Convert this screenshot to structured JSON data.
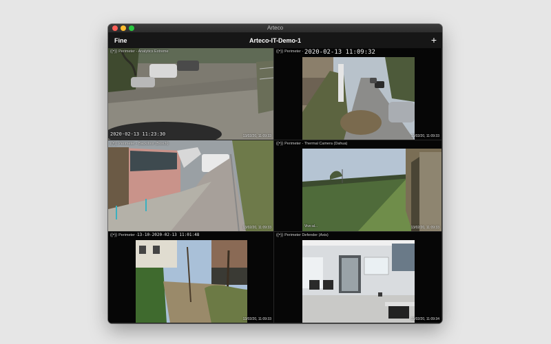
{
  "window": {
    "title": "Arteco",
    "toolbar": {
      "done_label": "Fine",
      "title": "Arteco-IT-Demo-1",
      "add_label": "+"
    }
  },
  "cameras": [
    {
      "label": "Perimeter - Analytics Extreme",
      "timestamp": "13/02/20, 11:09:33",
      "osd": "2020-02-13 11:23:30"
    },
    {
      "label": "Perimeter - ",
      "timestamp": "13/02/20, 11:09:33",
      "osd": "2020-02-13 11:09:32"
    },
    {
      "label": "Perimeter - Backdoor (Bosch)",
      "timestamp": "13/02/20, 11:09:33"
    },
    {
      "label": "Perimeter - Thermal Camera (Dahua)",
      "timestamp": "13/02/20, 11:09:33",
      "osd": "Vivo al..."
    },
    {
      "label": "Perimeter - ",
      "timestamp": "13/02/20, 11:09:33",
      "osd": "13-10-2020-02-13 11:01:48"
    },
    {
      "label": "Perimeter Defender (Axis)",
      "timestamp": "13/02/20, 11:09:34"
    }
  ]
}
